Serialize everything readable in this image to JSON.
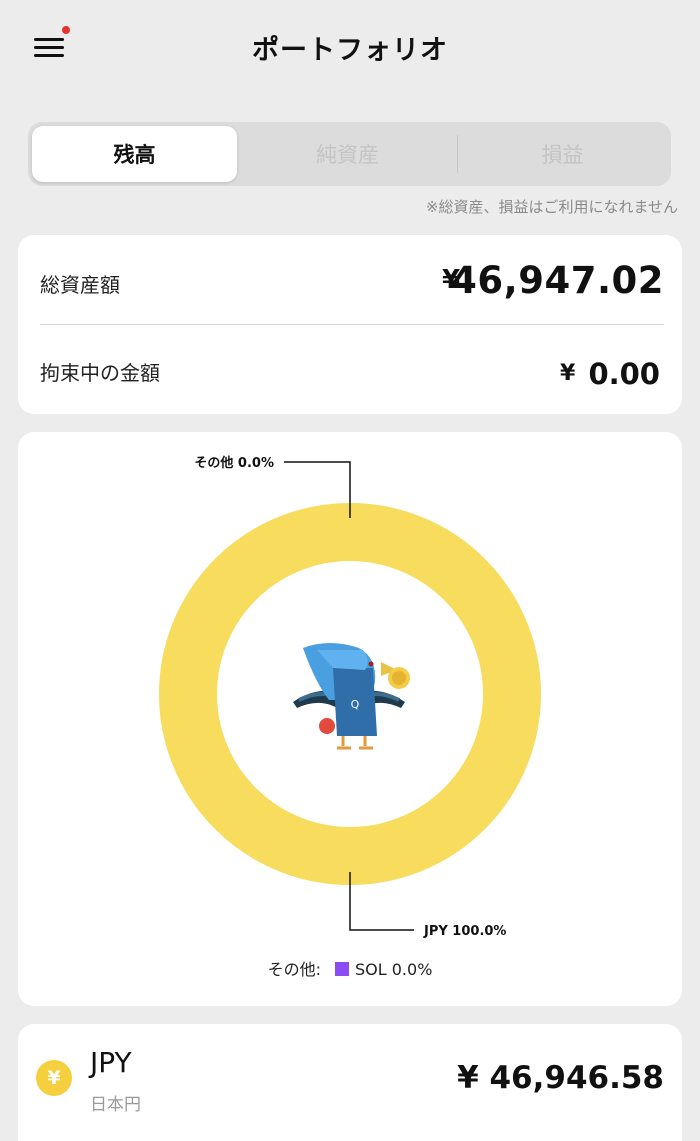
{
  "header": {
    "title": "ポートフォリオ",
    "menu_icon": "hamburger-menu-icon",
    "notification_color": "#e8312a"
  },
  "segments": {
    "items": [
      "残高",
      "純資産",
      "損益"
    ],
    "active_index": 0,
    "note": "※総資産、損益はご利用になれません"
  },
  "balance": {
    "total_label": "総資産額",
    "total_currency": "¥",
    "total_value": "46,947.02",
    "locked_label": "拘束中の金額",
    "locked_currency": "¥",
    "locked_value": "0.00"
  },
  "chart_data": {
    "type": "pie",
    "style": "donut",
    "categories": [
      "JPY",
      "その他"
    ],
    "values": [
      100.0,
      0.0
    ],
    "colors": [
      "#f7dc5e",
      "#8b4cf5"
    ],
    "labels": [
      "JPY 100.0%",
      "その他 0.0%"
    ],
    "center_icon": "bird-mascot-icon",
    "legend": {
      "prefix": "その他:",
      "items": [
        {
          "name": "SOL",
          "text": "SOL 0.0%",
          "color": "#8b4cf5"
        }
      ]
    }
  },
  "assets": [
    {
      "icon": "yen-coin-icon",
      "icon_glyph": "¥",
      "code": "JPY",
      "name": "日本円",
      "amount": "¥ 46,946.58",
      "color": "#f6cf3e"
    }
  ]
}
